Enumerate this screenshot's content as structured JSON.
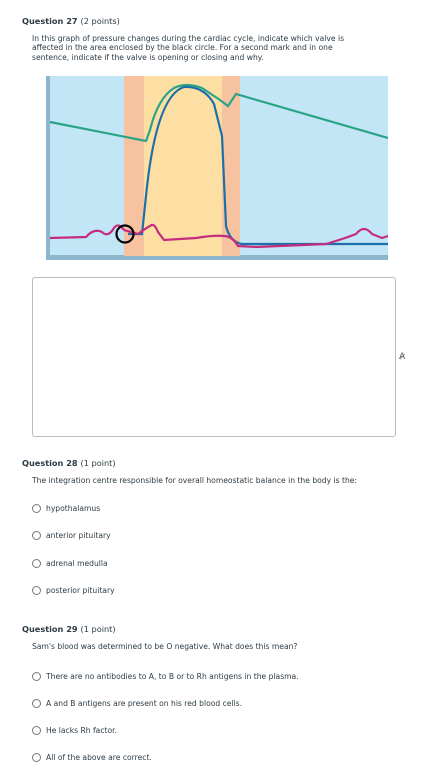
{
  "q27": {
    "title": "Question 27",
    "points": "(2 points)",
    "prompt_lines": [
      "In this graph of pressure changes during the cardiac cycle, indicate which valve is",
      "affected in the area enclosed by the black circle.  For a second mark and in one",
      "sentence, indicate if the valve is opening or closing and why."
    ],
    "colors": {
      "bg": "#c3e6f7",
      "atrial": "#f7c2a0",
      "ventricular": "#fddfa4",
      "teal": "#2aa387",
      "magenta": "#c42d7f",
      "blue": "#1d6fa8"
    }
  },
  "editor": {
    "spell_icon": "spellcheck-icon",
    "spell_glyph": "A̷"
  },
  "q28": {
    "title": "Question 28",
    "points": "(1 point)",
    "prompt": "The integration centre responsible for overall homeostatic balance in the body is the:",
    "options": [
      "hypothalamus",
      "anterior pituitary",
      "adrenal medulla",
      "posterior pituitary"
    ]
  },
  "q29": {
    "title": "Question 29",
    "points": "(1 point)",
    "prompt": "Sam's blood was determined to be O negative.  What does this mean?",
    "options": [
      "There are no antibodies to A, to B or to Rh antigens in the plasma.",
      "A and B antigens are present on his red blood cells.",
      "He lacks Rh factor.",
      "All of the above are correct."
    ]
  }
}
